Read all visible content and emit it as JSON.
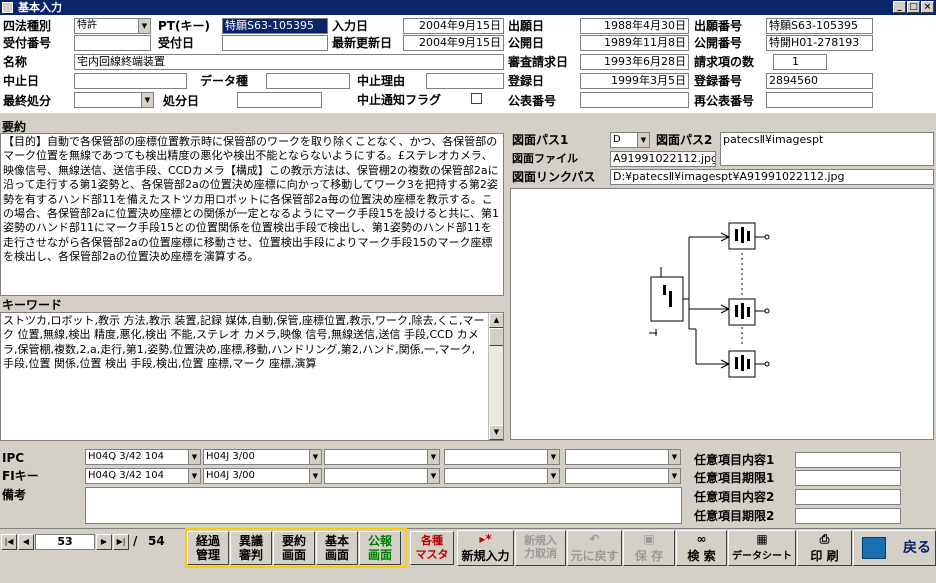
{
  "window": {
    "title": "基本入力",
    "btn_min": "_",
    "btn_max": "□",
    "btn_close": "×"
  },
  "header": {
    "shiho_shubetsu_label": "四法種別",
    "shiho_shubetsu_value": "特許",
    "pt_key_label": "PT(キー)",
    "pt_key_value": "特願S63-105395",
    "nyuryokubi_label": "入力日",
    "nyuryokubi_value": "2004年9月15日",
    "shutsuganbi_label": "出願日",
    "shutsuganbi_value": "1988年4月30日",
    "shutsugan_bango_label": "出願番号",
    "shutsugan_bango_value": "特願S63-105395",
    "uketsuke_bango_label": "受付番号",
    "uketsuke_bango_value": "",
    "uketsukebi_label": "受付日",
    "uketsukebi_value": "",
    "saishin_koshinbi_label": "最新更新日",
    "saishin_koshinbi_value": "2004年9月15日",
    "kokaibi_label": "公開日",
    "kokaibi_value": "1989年11月8日",
    "kokai_bango_label": "公開番号",
    "kokai_bango_value": "特開H01-278193",
    "meisho_label": "名称",
    "meisho_value": "宅内回線終端装置",
    "shinsa_seikyubi_label": "審査請求日",
    "shinsa_seikyubi_value": "1993年6月28日",
    "seikyu_komoku_label": "請求項の数",
    "seikyu_komoku_value": "1",
    "chushibi_label": "中止日",
    "chushibi_value": "",
    "datashu_label": "データ種",
    "datashu_value": "",
    "chushi_riyu_label": "中止理由",
    "chushi_riyu_value": "",
    "torokubi_label": "登録日",
    "torokubi_value": "1999年3月5日",
    "toroku_bango_label": "登録番号",
    "toroku_bango_value": "2894560",
    "saishu_shobun_label": "最終処分",
    "saishu_shobun_value": "",
    "shobunbi_label": "処分日",
    "shobunbi_value": "",
    "chushi_tsuchi_label": "中止通知フラグ",
    "kohyo_bango_label": "公表番号",
    "kohyo_bango_value": "",
    "saikohyo_bango_label": "再公表番号",
    "saikohyo_bango_value": ""
  },
  "summary": {
    "label": "要約",
    "text": "【目的】自動で各保管部の座標位置教示時に保管部のワークを取り除くことなく、かつ、各保管部のマーク位置を無線であつても検出精度の悪化や検出不能とならないようにする。£ステレオカメラ、映像信号、無線送信、送信手段、CCDカメラ【構成】この教示方法は、保管棚2の複数の保管部2aに沿って走行する第1姿勢と、各保管部2aの位置決め座標に向かって移動してワーク3を把持する第2姿勢を有するハンド部11を備えたストツカ用ロボットに各保管部2a毎の位置決め座標を教示する。この場合、各保管部2aに位置決め座標との関係が一定となるようにマーク手段15を設けると共に、第1姿勢のハンド部11にマーク手段15との位置関係を位置検出手段で検出し、第1姿勢のハンド部11を走行させながら各保管部2aの位置座標に移動させ、位置検出手段によりマーク手段15のマーク座標を検出し、各保管部2aの位置決め座標を演算する。"
  },
  "keyword": {
    "label": "キーワード",
    "text": "ストツカ,ロボット,教示 方法,教示 装置,記録 媒体,自動,保管,座標位置,教示,ワーク,除去,くこ,マーク 位置,無線,検出 精度,悪化,検出 不能,ステレオ カメラ,映像 信号,無線送信,送信 手段,CCD カメラ,保管棚,複数,2,a,走行,第1,姿勢,位置決め,座標,移動,ハンドリング,第2,ハンド,関係,一,マーク,手段,位置 関係,位置 検出 手段,検出,位置 座標,マーク 座標,演算"
  },
  "drawing": {
    "path1_label": "図面パス1",
    "path1_value": "D",
    "path2_label": "図面パス2",
    "path2_value": "patecsⅡ¥imagespt",
    "file_label": "図面ファイル",
    "file_value": "A91991022112.jpg",
    "link_label": "図面リンクパス",
    "link_value": "D:¥patecsⅡ¥imagespt¥A91991022112.jpg"
  },
  "ipc": {
    "label": "IPC",
    "values": [
      "H04Q 3/42 104",
      "H04J 3/00",
      "",
      "",
      ""
    ]
  },
  "fi": {
    "label": "FIキー",
    "values": [
      "H04Q 3/42 104",
      "H04J 3/00",
      "",
      "",
      ""
    ]
  },
  "biko": {
    "label": "備考",
    "value": ""
  },
  "optional": [
    {
      "label": "任意項目内容1",
      "value": ""
    },
    {
      "label": "任意項目期限1",
      "value": ""
    },
    {
      "label": "任意項目内容2",
      "value": ""
    },
    {
      "label": "任意項目期限2",
      "value": ""
    }
  ],
  "nav": {
    "current": "53",
    "sep": "/",
    "total": "54"
  },
  "buttons": {
    "keika": "経過\n管理",
    "igi": "異議\n審判",
    "yoyaku": "要約\n画面",
    "kihon": "基本\n画面",
    "koho": "公報\n画面",
    "masta": "各種\nマスタ",
    "shinki": "新規入力",
    "cancel": "新規入\n力取消",
    "undo": "元に戻す",
    "save": "保 存",
    "search": "検 索",
    "datasheet": "データシート",
    "print": "印 刷",
    "back": "戻る"
  },
  "colors": {
    "titlebar": "#0a246a",
    "yellow_border": "#ffcc00",
    "masta_text": "#c00000",
    "koho_text": "#008000"
  }
}
